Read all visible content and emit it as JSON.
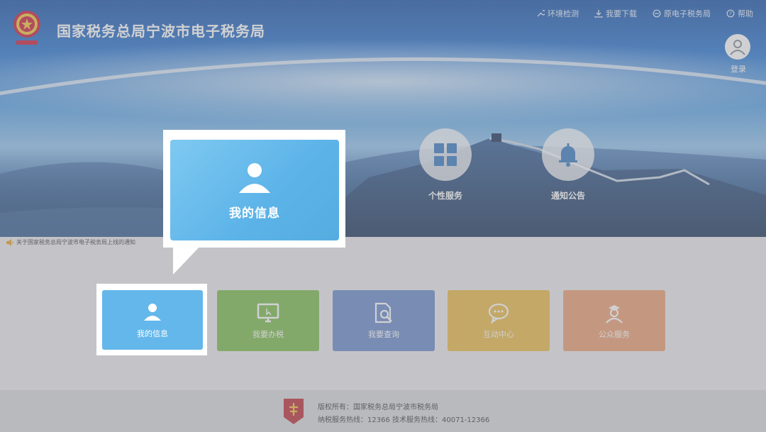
{
  "header": {
    "site_title": "国家税务总局宁波市电子税务局",
    "links": [
      {
        "label": "环境检测",
        "icon": "wrench-icon"
      },
      {
        "label": "我要下载",
        "icon": "download-icon"
      },
      {
        "label": "原电子税务局",
        "icon": "switch-icon"
      },
      {
        "label": "帮助",
        "icon": "help-icon"
      }
    ],
    "login_label": "登录"
  },
  "round_services": [
    {
      "label": "个性服务",
      "icon": "grid-icon"
    },
    {
      "label": "通知公告",
      "icon": "bell-icon"
    }
  ],
  "notice": {
    "text": "关于国家税务总局宁波市电子税务局上线的通知"
  },
  "tiles": [
    {
      "label": "我的信息",
      "color": "#64b7ea",
      "icon": "user-icon"
    },
    {
      "label": "我要办税",
      "color": "#74b843",
      "icon": "monitor-icon"
    },
    {
      "label": "我要查询",
      "color": "#5f83c9",
      "icon": "document-search-icon"
    },
    {
      "label": "互动中心",
      "color": "#e7b73c",
      "icon": "chat-icon"
    },
    {
      "label": "公众服务",
      "color": "#e99a6a",
      "icon": "people-icon"
    }
  ],
  "callout": {
    "label": "我的信息"
  },
  "footer": {
    "copyright": "版权所有：国家税务总局宁波市税务局",
    "hotline": "纳税服务热线：12366 技术服务热线：40071-12366"
  }
}
